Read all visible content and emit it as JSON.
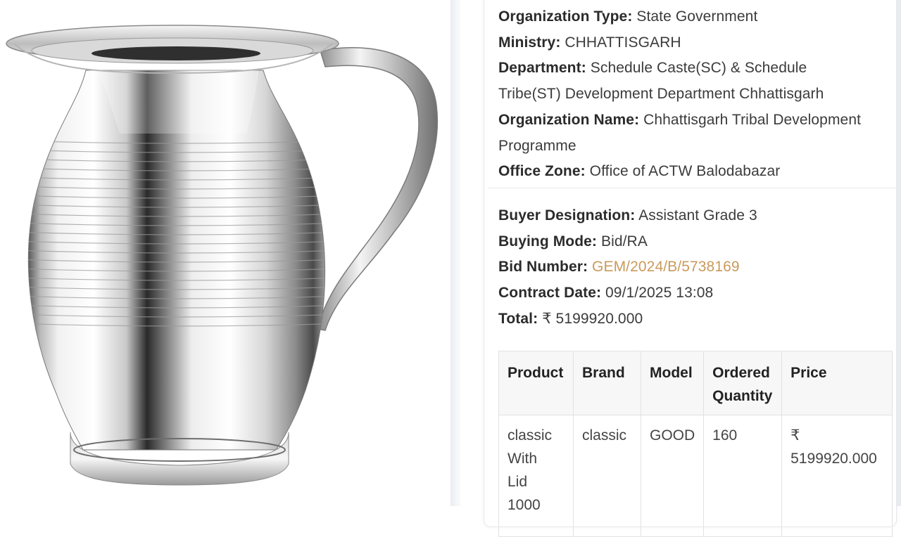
{
  "colors": {
    "link": "#c99a5c",
    "label": "#2b2b2b",
    "value": "#3b3b3b",
    "table_header_bg": "#f7f7f7"
  },
  "organization": {
    "type": {
      "label": "Organization Type:",
      "value": "State Government"
    },
    "ministry": {
      "label": "Ministry:",
      "value": "CHHATTISGARH"
    },
    "department": {
      "label": "Department:",
      "value_line1": "Schedule Caste(SC) & Schedule",
      "value_line2": "Tribe(ST) Development Department Chhattisgarh"
    },
    "name": {
      "label": "Organization Name:",
      "value_line1": "Chhattisgarh Tribal Development",
      "value_line2": "Programme"
    },
    "office_zone": {
      "label": "Office Zone:",
      "value": "Office of ACTW Balodabazar"
    }
  },
  "buyer": {
    "designation": {
      "label": "Buyer Designation:",
      "value": "Assistant Grade 3"
    },
    "buying_mode": {
      "label": "Buying Mode:",
      "value": "Bid/RA"
    },
    "bid_number": {
      "label": "Bid Number:",
      "value": "GEM/2024/B/5738169"
    },
    "contract_date": {
      "label": "Contract Date:",
      "value": "09/1/2025 13:08"
    },
    "total": {
      "label": "Total:",
      "value": "₹ 5199920.000"
    }
  },
  "table": {
    "headers": {
      "product": "Product",
      "brand": "Brand",
      "model": "Model",
      "qty_line1": "Ordered",
      "qty_line2": "Quantity",
      "price": "Price"
    },
    "rows": [
      {
        "product_line1": "classic",
        "product_line2": "With",
        "product_line3": "Lid",
        "product_line4": "1000",
        "brand": "classic",
        "model": "GOOD",
        "quantity": "160",
        "price_line1": "₹",
        "price_line2": "5199920.000"
      }
    ]
  },
  "image": {
    "icon": "steel-jug-photo"
  }
}
